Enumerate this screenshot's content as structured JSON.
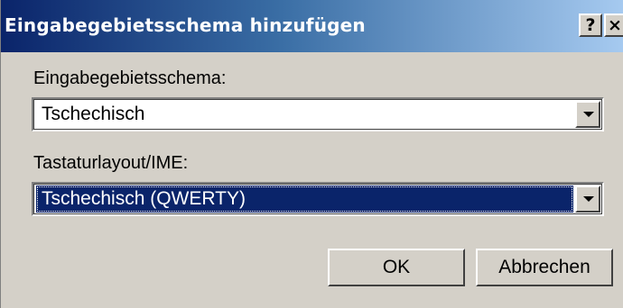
{
  "window": {
    "title": "Eingabegebietsschema hinzufügen",
    "help_label": "?",
    "close_label": "×"
  },
  "form": {
    "locale_label": "Eingabegebietsschema:",
    "locale_value": "Tschechisch",
    "keyboard_label": "Tastaturlayout/IME:",
    "keyboard_value": "Tschechisch (QWERTY)"
  },
  "buttons": {
    "ok_label": "OK",
    "cancel_label": "Abbrechen"
  },
  "colors": {
    "titlebar_start": "#0a246a",
    "titlebar_end": "#a6caf0",
    "selection": "#0a246a",
    "face": "#d4d0c8"
  }
}
